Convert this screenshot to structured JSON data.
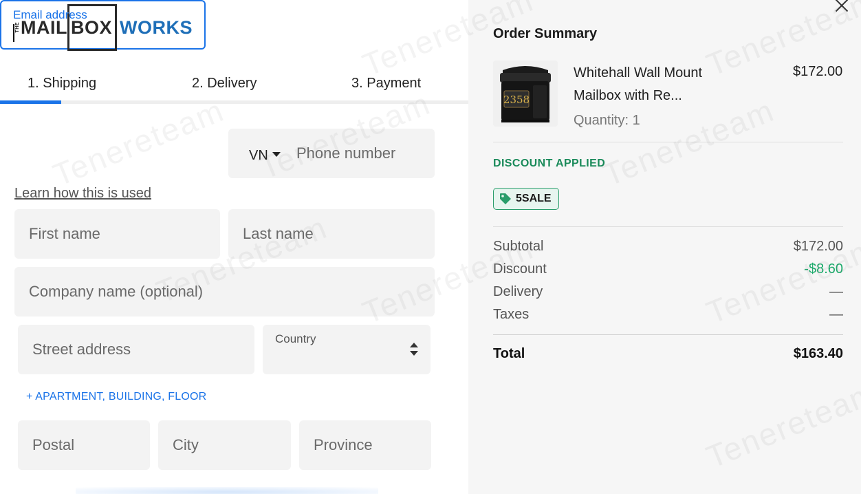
{
  "logo": {
    "the": "THE",
    "mail": "MAIL",
    "box": "BOX",
    "works": "WORKS"
  },
  "steps": [
    {
      "label": "1. Shipping"
    },
    {
      "label": "2. Delivery"
    },
    {
      "label": "3. Payment"
    }
  ],
  "checkout_progress": 0.13,
  "form": {
    "email_label": "Email address",
    "email_value": "",
    "country_code": "VN",
    "phone_placeholder": "Phone number",
    "learn_link": "Learn how this is used",
    "first_name_placeholder": "First name",
    "last_name_placeholder": "Last name",
    "company_placeholder": "Company name (optional)",
    "street_placeholder": "Street address",
    "country_label": "Country",
    "apartment_link": "+ APARTMENT, BUILDING, FLOOR",
    "postal_placeholder": "Postal",
    "city_placeholder": "City",
    "province_placeholder": "Province"
  },
  "summary": {
    "title": "Order Summary",
    "product": {
      "name": "Whitehall Wall Mount Mailbox with Re...",
      "price": "$172.00",
      "quantity": "Quantity: 1",
      "image_number": "2358"
    },
    "discount_applied_label": "DISCOUNT APPLIED",
    "discount_code": "5SALE",
    "subtotal_label": "Subtotal",
    "subtotal_value": "$172.00",
    "discount_label": "Discount",
    "discount_value": "-$8.60",
    "delivery_label": "Delivery",
    "delivery_value": "—",
    "taxes_label": "Taxes",
    "taxes_value": "—",
    "total_label": "Total",
    "total_value": "$163.40"
  },
  "watermark_text": "Tenereteam",
  "colors": {
    "accent": "#1a73e8",
    "brand_blue": "#1f6fb8",
    "discount_green": "#1a8a5a",
    "discount_value": "#1aaa6a"
  }
}
